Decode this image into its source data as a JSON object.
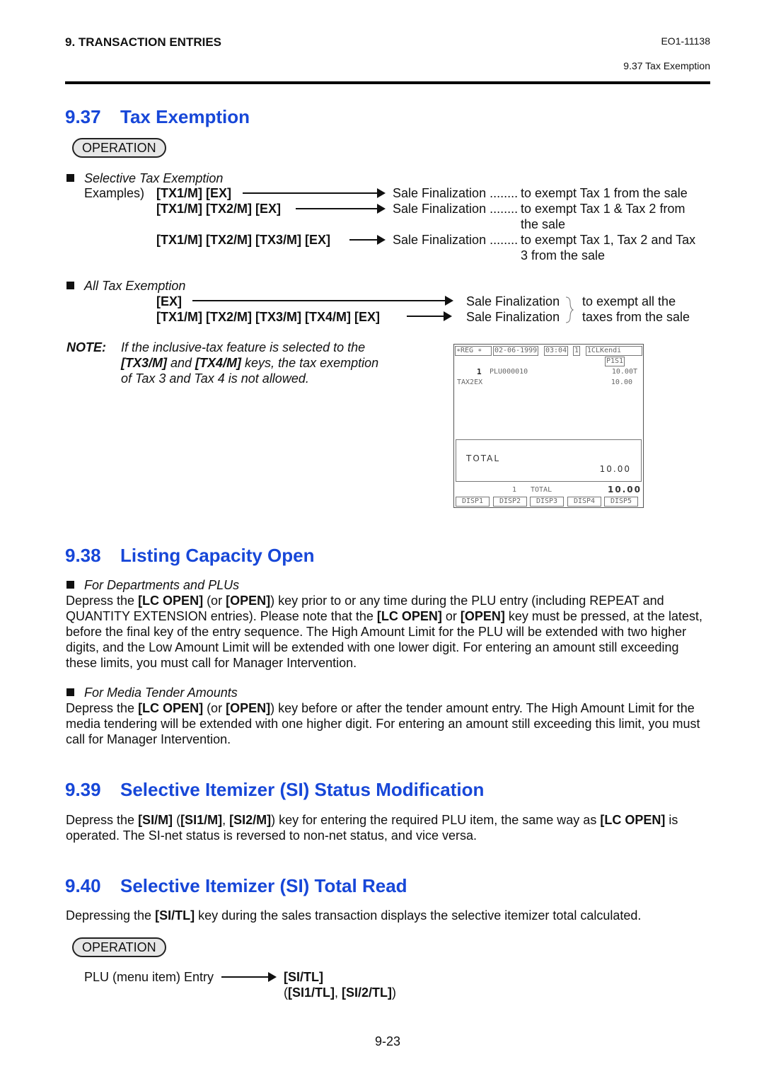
{
  "header": {
    "chapter": "9.   TRANSACTION ENTRIES",
    "doc_id": "EO1-11138",
    "section_ref": "9.37  Tax Exemption"
  },
  "s937": {
    "num": "9.37",
    "title": "Tax Exemption",
    "operation": "OPERATION",
    "selective": {
      "heading": "Selective Tax Exemption",
      "examples_label": "Examples)",
      "rows": [
        {
          "keys": "[TX1/M]  [EX]",
          "result": "Sale Finalization ........",
          "desc": [
            "to exempt Tax 1 from the sale"
          ]
        },
        {
          "keys": "[TX1/M]  [TX2/M]  [EX]",
          "result": "Sale Finalization ........",
          "desc": [
            "to exempt Tax 1 & Tax 2 from",
            "the sale"
          ]
        },
        {
          "keys": "[TX1/M]  [TX2/M]  [TX3/M]  [EX]",
          "result": "Sale Finalization ........",
          "desc": [
            "to exempt Tax 1, Tax 2 and Tax",
            "3 from the sale"
          ]
        }
      ]
    },
    "all": {
      "heading": "All Tax Exemption",
      "rows": [
        {
          "keys": "[EX]",
          "result": "Sale Finalization"
        },
        {
          "keys": "[TX1/M]  [TX2/M]  [TX3/M]  [TX4/M]  [EX]",
          "result": "Sale Finalization"
        }
      ],
      "desc": [
        "to exempt all the",
        "taxes  from the sale"
      ]
    },
    "note": {
      "label": "NOTE:",
      "lines": [
        [
          {
            "t": "If the inclusive-tax feature is selected to the"
          }
        ],
        [
          {
            "t": "[TX3/M]",
            "b": true
          },
          {
            "t": " and "
          },
          {
            "t": "[TX4/M]",
            "b": true
          },
          {
            "t": " keys, the tax exemption"
          }
        ],
        [
          {
            "t": "of Tax 3 and Tax 4 is not allowed."
          }
        ]
      ]
    },
    "display": {
      "mode": "∗REG  ∗",
      "date": "02-06-1999",
      "time": "03:04",
      "reg_no": "1",
      "clerk": "1CLKendi",
      "page": "P1S1",
      "item_qty": "1",
      "item_name": "PLU000010",
      "item_amount": "10.00T",
      "tax_label": "TAX2EX",
      "tax_amount": "10.00",
      "total_label": "TOTAL",
      "total_amount": "10.00",
      "footer_qty": "1",
      "footer_label": "TOTAL",
      "footer_amount": "10.00",
      "buttons": [
        "DISP1",
        "DISP2",
        "DISP3",
        "DISP4",
        "DISP5"
      ]
    }
  },
  "s938": {
    "num": "9.38",
    "title": "Listing Capacity Open",
    "dept": {
      "heading": "For Departments and PLUs",
      "text": [
        {
          "t": "Depress the "
        },
        {
          "t": "[LC OPEN]",
          "b": true
        },
        {
          "t": " (or "
        },
        {
          "t": "[OPEN]",
          "b": true
        },
        {
          "t": ") key prior to or any time during the PLU entry (including REPEAT and QUANTITY EXTENSION entries). Please note that the "
        },
        {
          "t": "[LC OPEN]",
          "b": true
        },
        {
          "t": " or "
        },
        {
          "t": "[OPEN]",
          "b": true
        },
        {
          "t": " key must be pressed, at the latest, before the final key of the entry sequence. The High Amount Limit for the PLU will be extended with two higher digits, and the Low Amount Limit will be extended with one lower digit. For entering an amount still exceeding these limits, you must call for Manager Intervention."
        }
      ]
    },
    "media": {
      "heading": "For Media Tender Amounts",
      "text": [
        {
          "t": "Depress the "
        },
        {
          "t": "[LC OPEN]",
          "b": true
        },
        {
          "t": " (or "
        },
        {
          "t": "[OPEN]",
          "b": true
        },
        {
          "t": ") key before or after the tender amount entry. The High Amount Limit for the media tendering will be extended with one higher digit. For entering an amount still exceeding this limit, you must call for Manager Intervention."
        }
      ]
    }
  },
  "s939": {
    "num": "9.39",
    "title": "Selective Itemizer (SI) Status Modification",
    "text": [
      {
        "t": "Depress the "
      },
      {
        "t": "[SI/M]",
        "b": true
      },
      {
        "t": " ("
      },
      {
        "t": "[SI1/M]",
        "b": true
      },
      {
        "t": ", "
      },
      {
        "t": "[SI2/M]",
        "b": true
      },
      {
        "t": ") key for entering the required PLU item, the same way as "
      },
      {
        "t": "[LC OPEN]",
        "b": true
      },
      {
        "t": " is operated. The SI-net status is reversed to non-net status, and vice versa."
      }
    ]
  },
  "s940": {
    "num": "9.40",
    "title": "Selective Itemizer (SI) Total Read",
    "text": [
      {
        "t": "Depressing the "
      },
      {
        "t": "[SI/TL]",
        "b": true
      },
      {
        "t": " key during the sales transaction displays the selective itemizer total calculated."
      }
    ],
    "operation": "OPERATION",
    "entry": "PLU (menu item) Entry",
    "key": "[SI/TL]",
    "alt": [
      {
        "t": "("
      },
      {
        "t": "[SI1/TL]",
        "b": true
      },
      {
        "t": ", "
      },
      {
        "t": "[SI/2/TL]",
        "b": true
      },
      {
        "t": ")"
      }
    ]
  },
  "footer": {
    "page_number": "9-23"
  },
  "colors": {
    "heading": "#1747d8"
  }
}
